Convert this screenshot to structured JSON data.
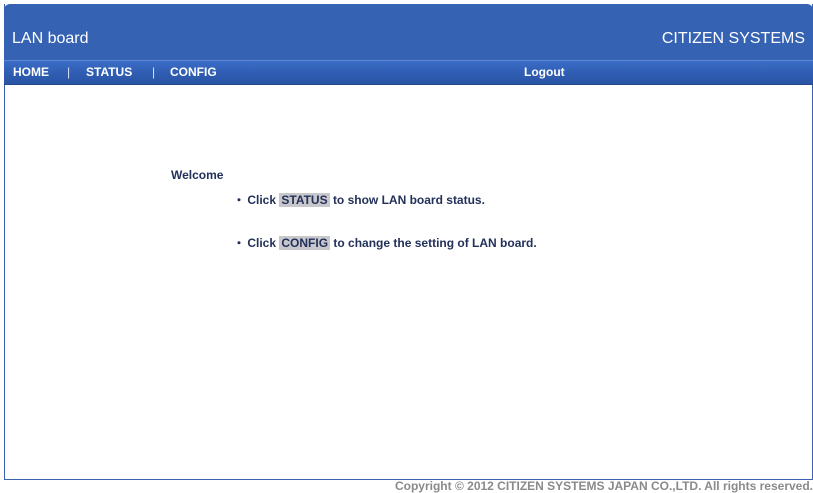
{
  "header": {
    "title": "LAN board",
    "brand": "CITIZEN SYSTEMS"
  },
  "nav": {
    "home": "HOME",
    "separator": "|",
    "status": "STATUS",
    "config": "CONFIG",
    "logout": "Logout"
  },
  "main": {
    "welcome": "Welcome",
    "bullet": "・",
    "items": [
      {
        "prefix": "Click",
        "link": "STATUS",
        "suffix": "to show LAN board status."
      },
      {
        "prefix": "Click",
        "link": "CONFIG",
        "suffix": "to change the setting of LAN board."
      }
    ]
  },
  "footer": {
    "copyright": "Copyright © 2012 CITIZEN SYSTEMS JAPAN CO.,LTD. All rights reserved."
  },
  "colors": {
    "header_blue": "#3562b3",
    "text_navy": "#22305a",
    "highlight_gray": "#c8c8cc"
  }
}
